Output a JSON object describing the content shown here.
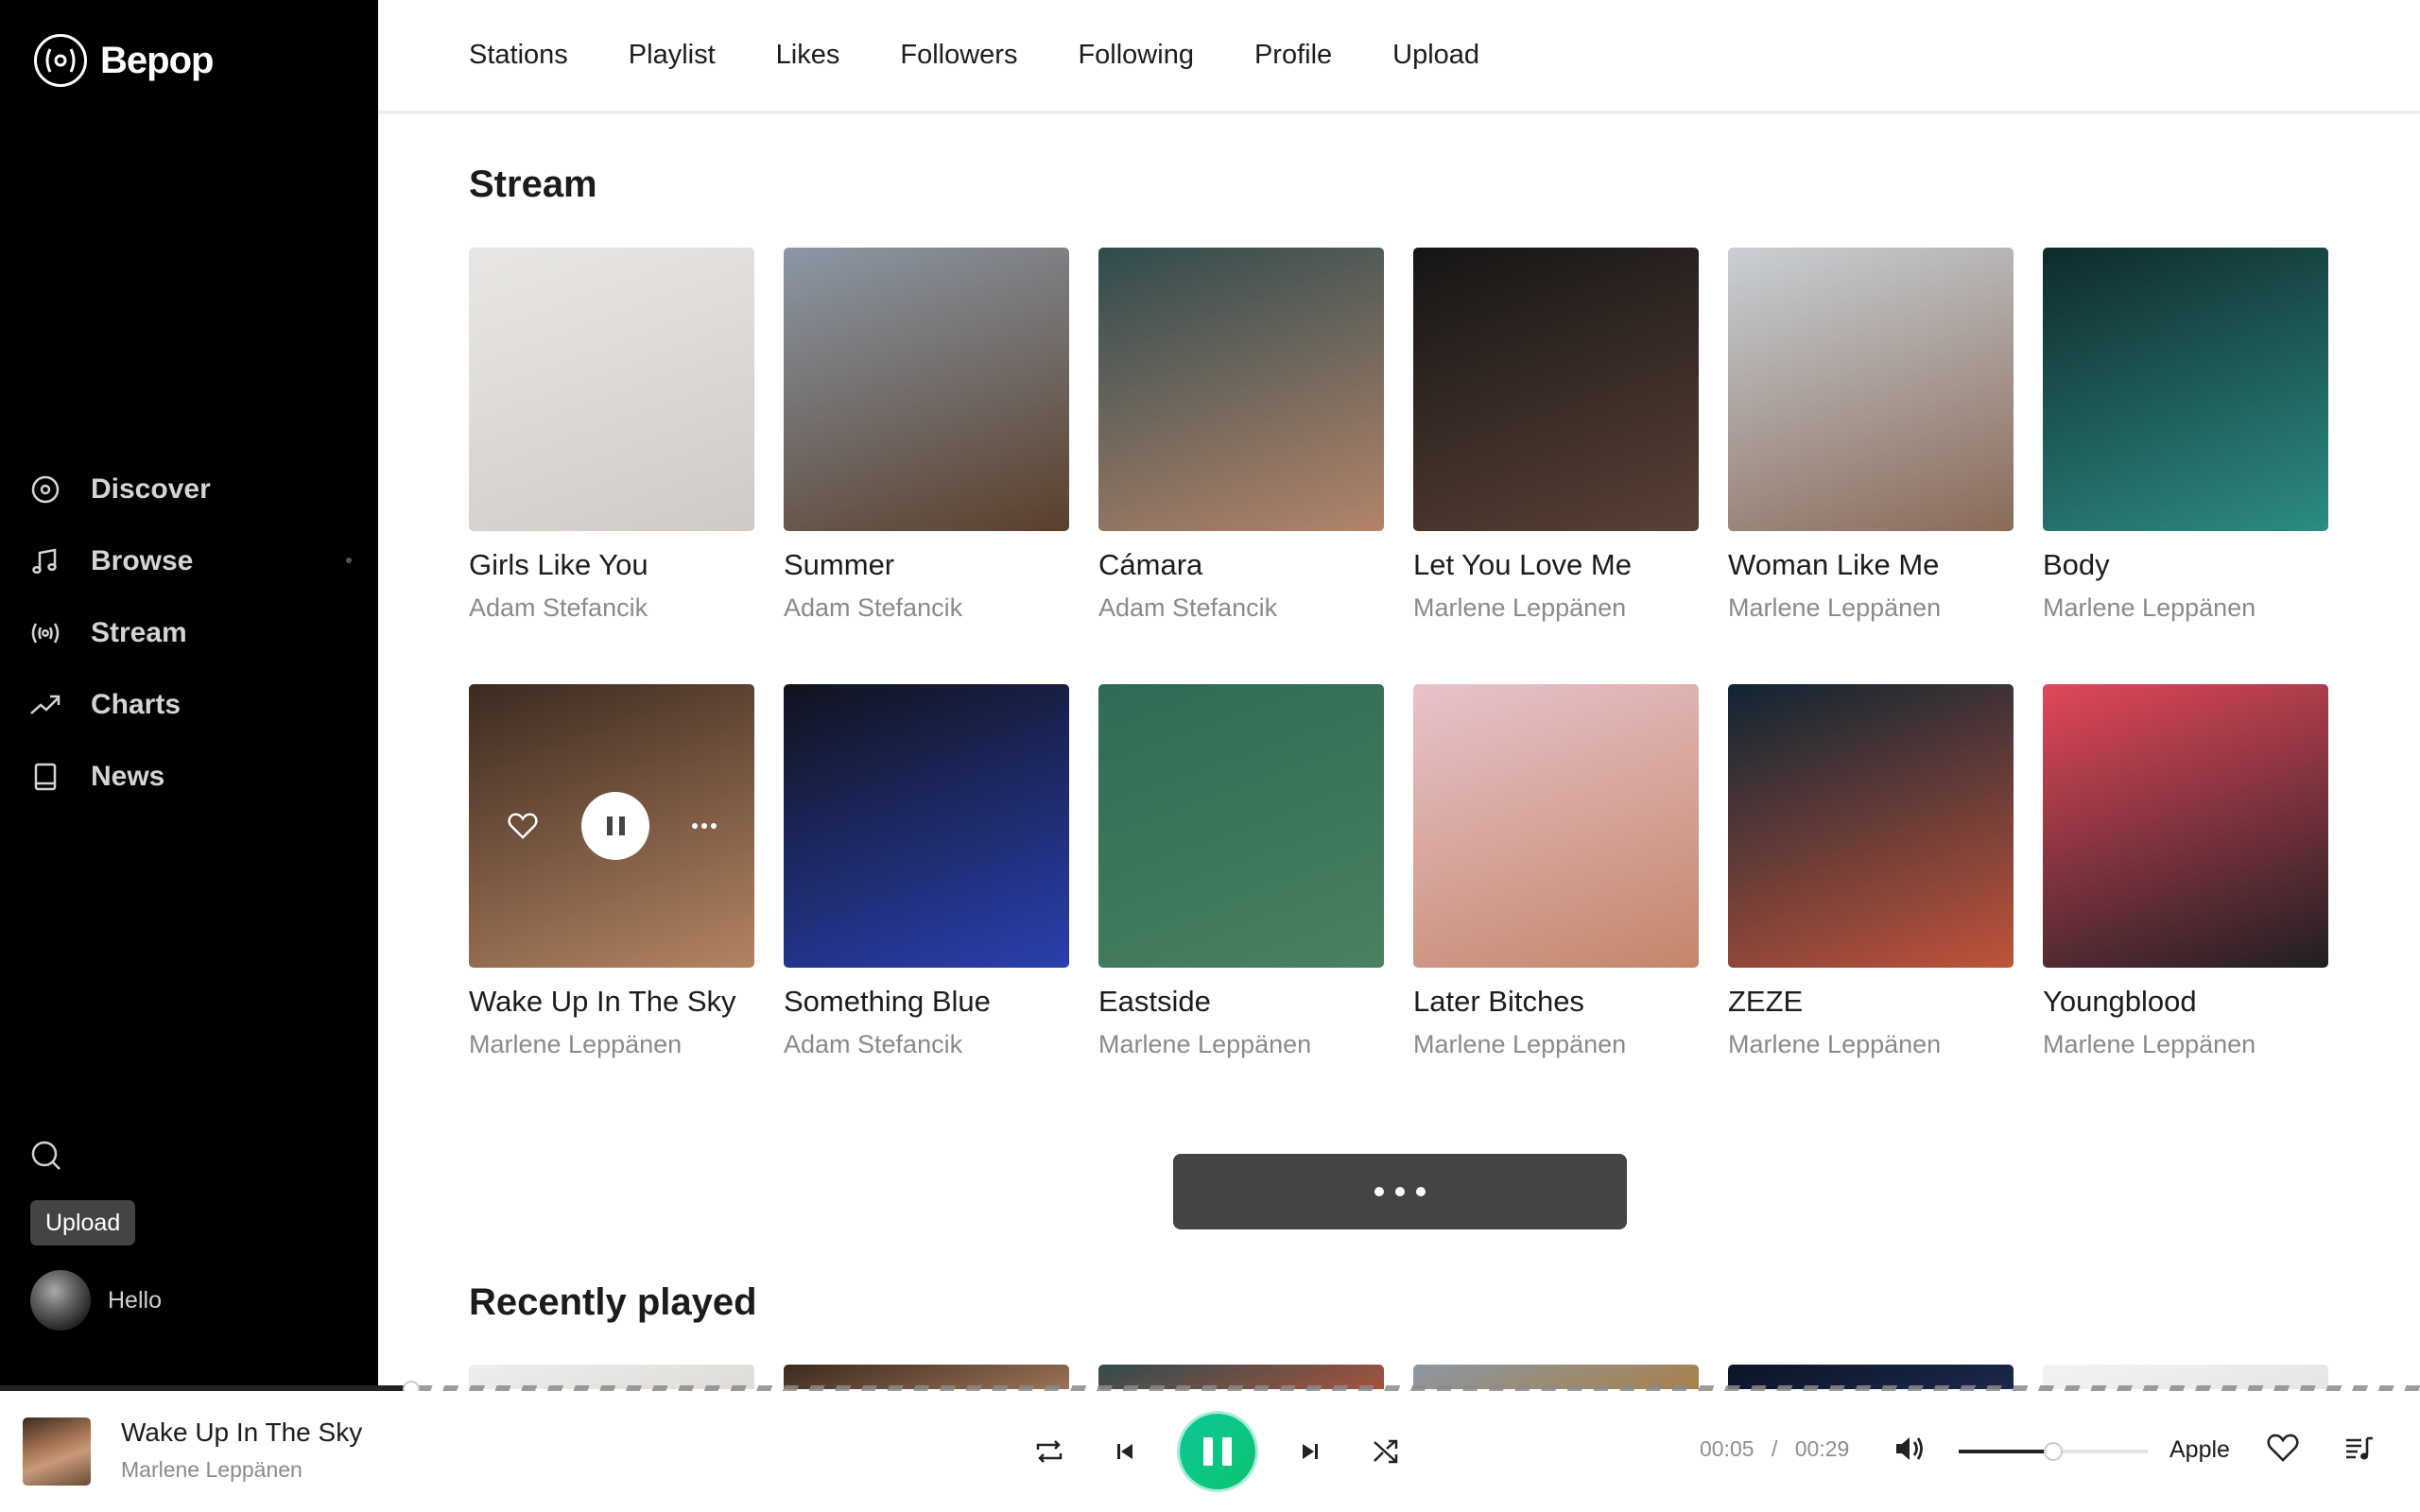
{
  "app": {
    "name": "Bepop"
  },
  "sidebar": {
    "items": [
      {
        "label": "Discover",
        "icon": "disc-icon"
      },
      {
        "label": "Browse",
        "icon": "music-note-icon",
        "has_dot": true
      },
      {
        "label": "Stream",
        "icon": "broadcast-icon"
      },
      {
        "label": "Charts",
        "icon": "trending-up-icon"
      },
      {
        "label": "News",
        "icon": "book-icon"
      }
    ],
    "upload_label": "Upload",
    "user_name": "Hello"
  },
  "topnav": [
    "Stations",
    "Playlist",
    "Likes",
    "Followers",
    "Following",
    "Profile",
    "Upload"
  ],
  "stream": {
    "title": "Stream",
    "rows": [
      [
        {
          "title": "Girls Like You",
          "artist": "Adam Stefancik",
          "colors": [
            "#e9e7e5",
            "#cfcac6"
          ]
        },
        {
          "title": "Summer",
          "artist": "Adam Stefancik",
          "colors": [
            "#8b98a6",
            "#5a3f2b"
          ]
        },
        {
          "title": "Cámara",
          "artist": "Adam Stefancik",
          "colors": [
            "#2f4b4e",
            "#b3846a"
          ]
        },
        {
          "title": "Let You Love Me",
          "artist": "Marlene Leppänen",
          "colors": [
            "#151515",
            "#5a4035"
          ]
        },
        {
          "title": "Woman Like Me",
          "artist": "Marlene Leppänen",
          "colors": [
            "#c9d0d6",
            "#8a6a58"
          ]
        },
        {
          "title": "Body",
          "artist": "Marlene Leppänen",
          "colors": [
            "#0f2a2c",
            "#2c8c83"
          ]
        }
      ],
      [
        {
          "title": "Wake Up In The Sky",
          "artist": "Marlene Leppänen",
          "colors": [
            "#3b2a20",
            "#b48462"
          ],
          "active": true
        },
        {
          "title": "Something Blue",
          "artist": "Adam Stefancik",
          "colors": [
            "#10131c",
            "#2a3fb0"
          ]
        },
        {
          "title": "Eastside",
          "artist": "Marlene Leppänen",
          "colors": [
            "#2f6a55",
            "#48825f"
          ]
        },
        {
          "title": "Later Bitches",
          "artist": "Marlene Leppänen",
          "colors": [
            "#e8c3cb",
            "#c4866a"
          ]
        },
        {
          "title": "ZEZE",
          "artist": "Marlene Leppänen",
          "colors": [
            "#0e2533",
            "#c0533a"
          ]
        },
        {
          "title": "Youngblood",
          "artist": "Marlene Leppänen",
          "colors": [
            "#e2475a",
            "#1f1f22"
          ]
        }
      ]
    ],
    "more_label": "•••"
  },
  "recently_played": {
    "title": "Recently played",
    "covers": [
      [
        "#efeeec",
        "#dcd6d0"
      ],
      [
        "#3b2a20",
        "#b48462"
      ],
      [
        "#2f4b4e",
        "#c4553a"
      ],
      [
        "#8b98a6",
        "#b07a30"
      ],
      [
        "#0c1426",
        "#1d2d55"
      ],
      [
        "#f3f3f3",
        "#e2e2e2"
      ]
    ]
  },
  "player": {
    "title": "Wake Up In The Sky",
    "artist": "Marlene Leppänen",
    "current_time": "00:05",
    "separator": "/",
    "duration": "00:29",
    "progress": 0.17,
    "volume": 0.5,
    "device": "Apple",
    "accent": "#0cc68a"
  }
}
